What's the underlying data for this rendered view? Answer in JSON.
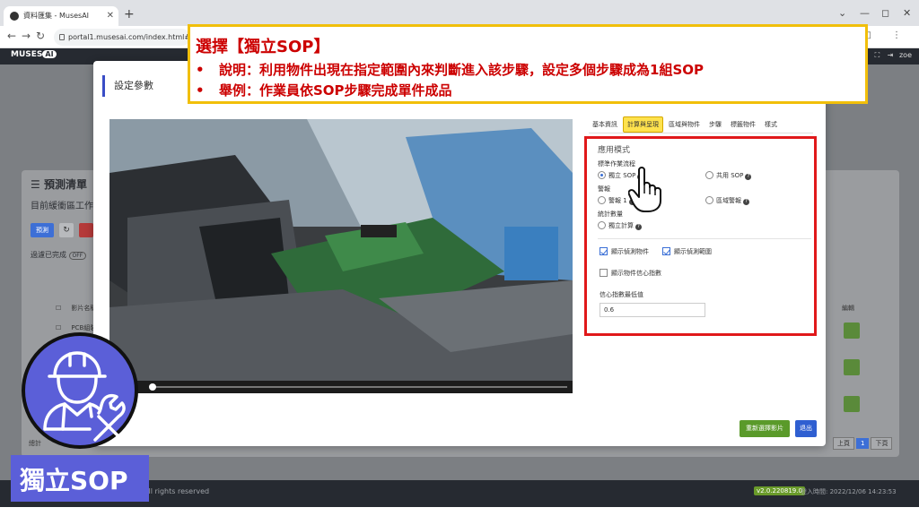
{
  "browser": {
    "tab_title": "資料匯集 - MusesAI",
    "new_tab": "+",
    "url": "portal1.musesai.com/index.html#app"
  },
  "app": {
    "logo_text": "MUSES",
    "logo_ai": "AI",
    "user": "zoe"
  },
  "background": {
    "panel_title": "預測清單",
    "panel_subtitle": "目前緩衝區工作",
    "btn_predict": "預測",
    "filter_label": "過濾已完成",
    "filter_toggle": "OFF",
    "col_video_name": "影片名稱",
    "cell_video": "PCB組裝.mp4",
    "col_edit": "編輯",
    "pager": [
      "上頁",
      "1",
      "下頁"
    ],
    "total_label": "總計"
  },
  "modal": {
    "title": "設定參數",
    "tabs": [
      "基本資訊",
      "計算與呈現",
      "區域與物件",
      "步驟",
      "標籤物件",
      "樣式"
    ],
    "active_tab": "計算與呈現",
    "section_title": "應用模式",
    "sop_label": "標準作業流程",
    "radio_standalone_sop": "獨立 SOP",
    "radio_shared_sop": "共用 SOP",
    "alarm_label": "警報",
    "radio_alarm1": "警報 1",
    "radio_region_alarm": "區域警報",
    "count_label": "統計數量",
    "radio_standalone_count": "獨立計算",
    "cb_show_detected": "顯示偵測物件",
    "cb_show_region": "顯示偵測範圍",
    "cb_show_confidence": "顯示物件信心指數",
    "threshold_label": "信心指數最低值",
    "threshold_value": "0.6",
    "btn_reselect": "重新選擇影片",
    "btn_exit": "退出"
  },
  "callout": {
    "title": "選擇【獨立SOP】",
    "line1_bullet": "•",
    "line1": "說明：利用物件出現在指定範圍內來判斷進入該步驟，設定多個步驟成為1組SOP",
    "line2_bullet": "•",
    "line2": "舉例：作業員依SOP步驟完成單件成品"
  },
  "badge": {
    "text": "獨立SOP"
  },
  "footer": {
    "copyright": "All rights reserved",
    "version": "v2.0.220819.0",
    "login": "登入時間: 2022/12/06 14:23:53"
  },
  "colors": {
    "accent_blue": "#3a4dc6",
    "highlight_red": "#e0181a",
    "callout_border": "#f1bf0a",
    "callout_text": "#cc0000",
    "icon_bg": "#5b5fd8",
    "tab_active": "#ffe24d",
    "btn_green": "#5a9a2a"
  }
}
